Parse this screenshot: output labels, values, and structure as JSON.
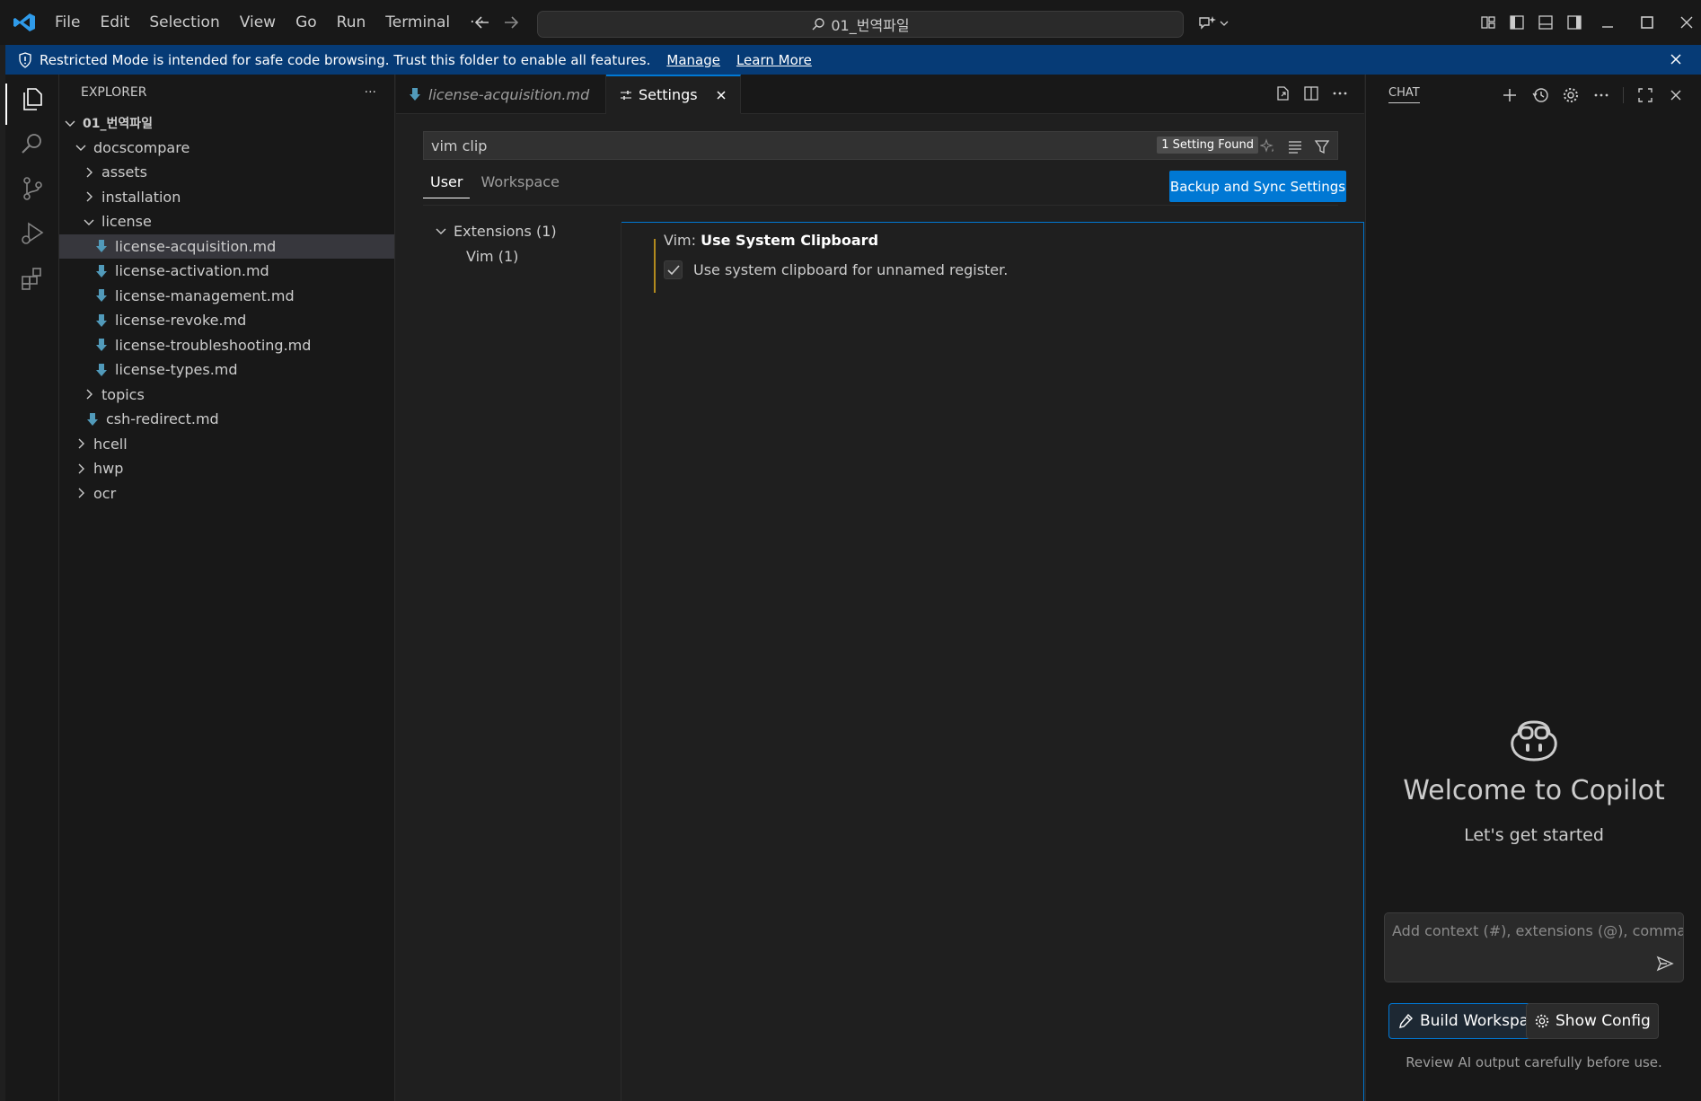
{
  "titlebar": {
    "menu": [
      "File",
      "Edit",
      "Selection",
      "View",
      "Go",
      "Run",
      "Terminal",
      "···"
    ],
    "command_center": "01_번역파일"
  },
  "banner": {
    "message": "Restricted Mode is intended for safe code browsing. Trust this folder to enable all features.",
    "manage": "Manage",
    "learn_more": "Learn More"
  },
  "explorer": {
    "title": "EXPLORER",
    "more": "···",
    "root": "01_번역파일",
    "items": [
      {
        "label": "docscompare"
      },
      {
        "label": "assets"
      },
      {
        "label": "installation"
      },
      {
        "label": "license"
      },
      {
        "label": "license-acquisition.md"
      },
      {
        "label": "license-activation.md"
      },
      {
        "label": "license-management.md"
      },
      {
        "label": "license-revoke.md"
      },
      {
        "label": "license-troubleshooting.md"
      },
      {
        "label": "license-types.md"
      },
      {
        "label": "topics"
      },
      {
        "label": "csh-redirect.md"
      },
      {
        "label": "hcell"
      },
      {
        "label": "hwp"
      },
      {
        "label": "ocr"
      }
    ]
  },
  "editor": {
    "tabs": [
      {
        "label": "license-acquisition.md"
      },
      {
        "label": "Settings"
      }
    ],
    "search_value": "vim clip",
    "found_badge": "1 Setting Found",
    "scope_tabs": [
      "User",
      "Workspace"
    ],
    "sync_button": "Backup and Sync Settings",
    "toc": [
      "Extensions (1)",
      "Vim (1)"
    ],
    "setting": {
      "category": "Vim: ",
      "name": "Use System Clipboard",
      "description": "Use system clipboard for unnamed register.",
      "checked": true
    }
  },
  "chat": {
    "title": "CHAT",
    "welcome_title": "Welcome to Copilot",
    "welcome_sub": "Let's get started",
    "input_placeholder": "Add context (#), extensions (@), commands",
    "build_button": "Build Workspace",
    "config_button": "Show Config",
    "note": "Review AI output carefully before use."
  },
  "colors": {
    "accent": "#0078d4",
    "banner": "#063b76",
    "markdown_icon": "#519aba",
    "modified_bar": "#b28a1e"
  }
}
